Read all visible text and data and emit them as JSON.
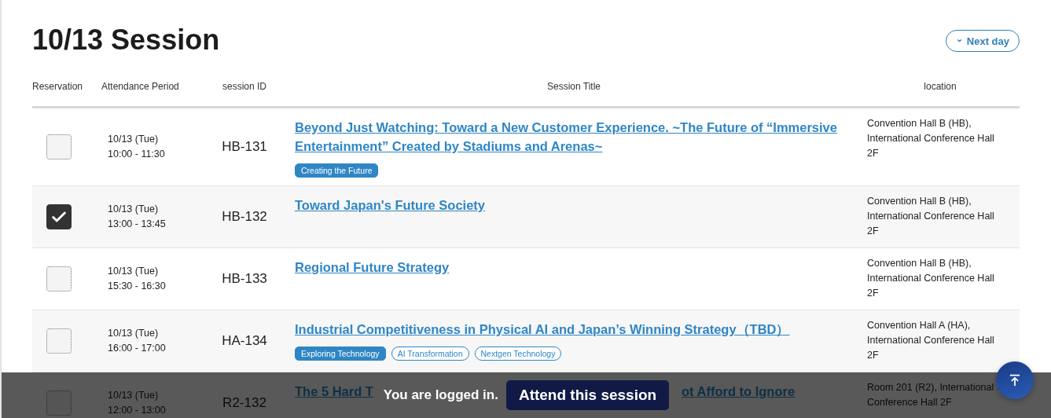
{
  "page_title": "10/13 Session",
  "next_day_button": {
    "icon": "⌄",
    "label": "Next day"
  },
  "table": {
    "columns": [
      "Reservation",
      "Attendance Period",
      "session ID",
      "Session Title",
      "location"
    ],
    "rows": [
      {
        "checked": false,
        "date": "10/13 (Tue)",
        "time": "10:00 - 11:30",
        "session_id": "HB-131",
        "title": "Beyond Just Watching: Toward a New Customer Experience. ~The Future of “Immersive Entertainment” Created by Stadiums and Arenas~",
        "tags": [
          {
            "label": "Creating the Future",
            "kind": "filled"
          }
        ],
        "location": "Convention Hall B (HB), International Conference Hall 2F"
      },
      {
        "checked": true,
        "date": "10/13 (Tue)",
        "time": "13:00 - 13:45",
        "session_id": "HB-132",
        "title": "Toward Japan's Future Society",
        "tags": [],
        "location": "Convention Hall B (HB), International Conference Hall 2F"
      },
      {
        "checked": false,
        "date": "10/13 (Tue)",
        "time": "15:30 - 16:30",
        "session_id": "HB-133",
        "title": "Regional Future Strategy",
        "tags": [],
        "location": "Convention Hall B (HB), International Conference Hall 2F"
      },
      {
        "checked": false,
        "date": "10/13 (Tue)",
        "time": "16:00 - 17:00",
        "session_id": "HA-134",
        "title": "Industrial Competitiveness in Physical AI and Japan’s Winning Strategy（TBD）",
        "tags": [
          {
            "label": "Exploring Technology",
            "kind": "filled"
          },
          {
            "label": "AI Transformation",
            "kind": "outline"
          },
          {
            "label": "Nextgen Technology",
            "kind": "outline"
          }
        ],
        "location": "Convention Hall A (HA), International Conference Hall 2F"
      },
      {
        "checked": false,
        "date": "10/13 (Tue)",
        "time": "12:00 - 13:00",
        "session_id": "R2-132",
        "title_parts": [
          "The 5 Hard T",
          "ot Afford to Ignore"
        ],
        "tags": [],
        "location": "Room 201 (R2), International Conference Hall 2F"
      }
    ]
  },
  "login_banner": {
    "message": "You are logged in.",
    "button": "Attend this session"
  }
}
